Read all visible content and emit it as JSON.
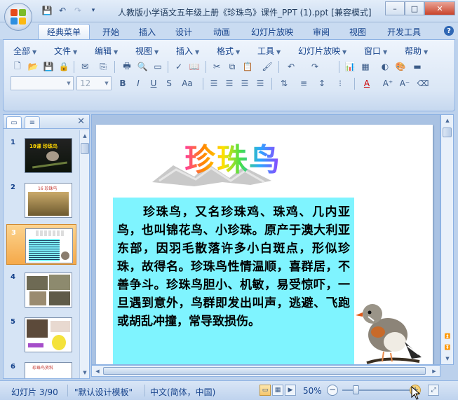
{
  "window": {
    "title": "人教版小学语文五年级上册《珍珠鸟》课件_PPT (1).ppt [兼容模式]",
    "controls": {
      "minimize": "–",
      "maximize": "□",
      "close": "✕"
    }
  },
  "quick_access": [
    "save-icon",
    "undo-icon",
    "redo-icon",
    "customize-icon"
  ],
  "ribbon_tabs": [
    {
      "label": "经典菜单",
      "active": true
    },
    {
      "label": "开始"
    },
    {
      "label": "插入"
    },
    {
      "label": "设计"
    },
    {
      "label": "动画"
    },
    {
      "label": "幻灯片放映"
    },
    {
      "label": "审阅"
    },
    {
      "label": "视图"
    },
    {
      "label": "开发工具"
    }
  ],
  "classic_menus": [
    "全部",
    "文件",
    "编辑",
    "视图",
    "插入",
    "格式",
    "工具",
    "幻灯片放映",
    "窗口",
    "帮助"
  ],
  "font": {
    "name": "",
    "size": "12"
  },
  "slide_panel": {
    "tabs": [
      "slides-tab",
      "outline-tab"
    ],
    "thumbnails": [
      {
        "num": "1",
        "caption": "18课 珍珠鸟"
      },
      {
        "num": "2",
        "caption": "16 珍珠鸟"
      },
      {
        "num": "3",
        "selected": true
      },
      {
        "num": "4"
      },
      {
        "num": "5"
      },
      {
        "num": "6",
        "caption": "珍珠鸟资料"
      }
    ]
  },
  "slide": {
    "title": "珍珠鸟",
    "body": "　　珍珠鸟，又名珍珠鸡、珠鸡、几内亚鸟，也叫锦花鸟、小珍珠。原产于澳大利亚东部，因羽毛散落许多小白斑点，形似珍珠，故得名。珍珠鸟性情温顺，喜群居，不善争斗。珍珠鸟胆小、机敏，易受惊吓，一旦遇到意外，鸟群即发出叫声，逃避、飞跑或胡乱冲撞，常导致损伤。"
  },
  "status": {
    "slide_info": "幻灯片 3/90",
    "template": "\"默认设计模板\"",
    "language": "中文(简体，中国)",
    "zoom": "50%",
    "zoom_level": 0.5
  },
  "colors": {
    "ribbon_bg": "#dbe7f6",
    "textbox_bg": "#7ff4ff",
    "selected_thumb": "#f5a94a"
  }
}
